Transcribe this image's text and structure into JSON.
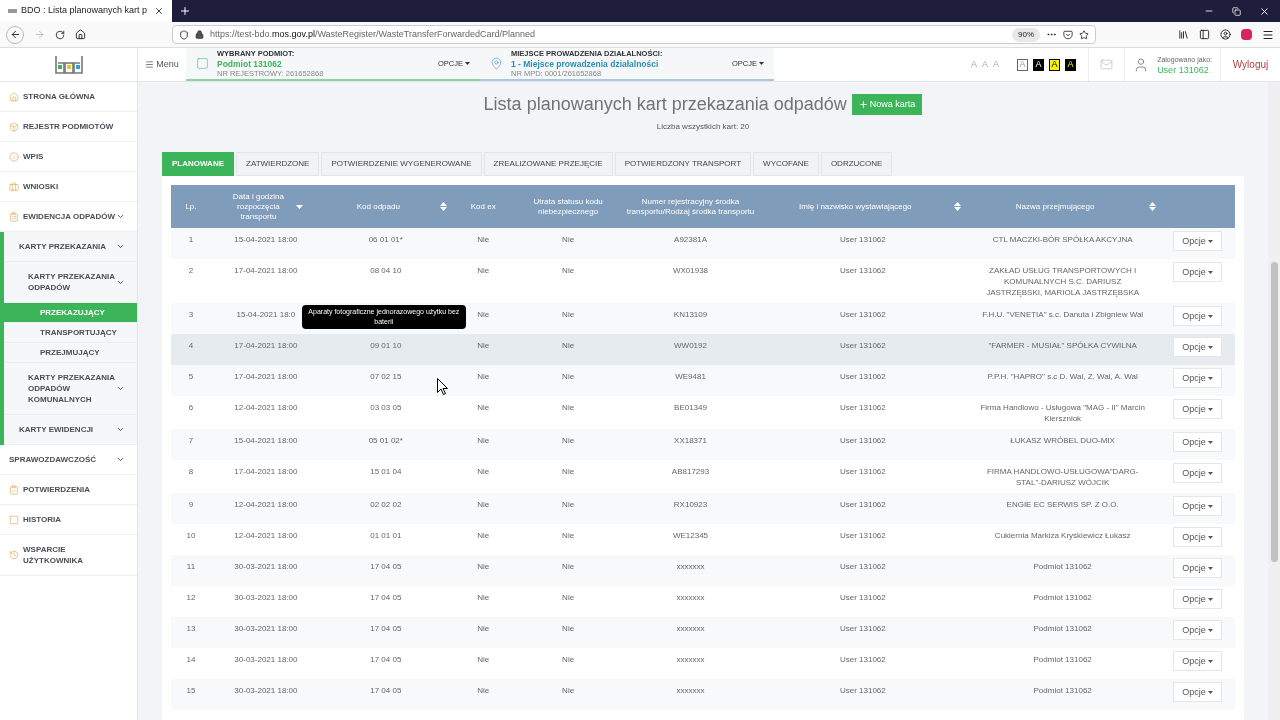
{
  "browser": {
    "tab_title": "BDO : Lista planowanych kart p",
    "url_host_prefix": "https://test-bdo.",
    "url_host": "mos.gov.pl",
    "url_path": "/WasteRegister/WasteTransferForwardedCard/Planned",
    "zoom": "90%"
  },
  "header": {
    "menu": "Menu",
    "subject": {
      "label": "WYBRANY PODMIOT:",
      "value": "Podmiot 131062",
      "sub": "NR REJESTROWY: 261652868",
      "options": "OPCJE"
    },
    "place": {
      "label": "MIEJSCE PROWADZENIA DZIAŁALNOŚCI:",
      "value": "1 - Miejsce prowadzenia działalności",
      "sub": "NR MPD: 0001/261652868",
      "options": "OPCJE"
    },
    "font_sizes": [
      "A",
      "A",
      "A"
    ],
    "contrast": [
      {
        "label": "A",
        "kind": "default"
      },
      {
        "label": "A",
        "kind": "dark"
      },
      {
        "label": "A",
        "kind": "yellow"
      },
      {
        "label": "A",
        "kind": "black-yellow"
      }
    ],
    "logged_label": "Zalogowano jako:",
    "user": "User 131062",
    "logout": "Wyloguj"
  },
  "sidebar": [
    {
      "label": "STRONA GŁÓWNA",
      "submenu": false
    },
    {
      "label": "REJESTR PODMIOTÓW",
      "submenu": false
    },
    {
      "label": "WPIS",
      "submenu": false
    },
    {
      "label": "WNIOSKI",
      "submenu": false
    },
    {
      "label": "EWIDENCJA ODPADÓW",
      "submenu": true,
      "children": [
        {
          "label": "KARTY PRZEKAZANIA",
          "submenu": true,
          "children": [
            {
              "label": "KARTY PRZEKAZANIA ODPADÓW",
              "submenu": true,
              "children": [
                {
                  "label": "PRZEKAZUJĄCY",
                  "selected": true
                },
                {
                  "label": "TRANSPORTUJĄCY",
                  "selected": false
                },
                {
                  "label": "PRZEJMUJĄCY",
                  "selected": false
                }
              ]
            },
            {
              "label": "KARTY PRZEKAZANIA ODPADÓW KOMUNALNYCH",
              "submenu": true
            }
          ]
        },
        {
          "label": "KARTY EWIDENCJI",
          "submenu": true
        }
      ]
    },
    {
      "label": "SPRAWOZDAWCZOŚĆ",
      "submenu": true
    },
    {
      "label": "POTWIERDZENIA",
      "submenu": false
    },
    {
      "label": "HISTORIA",
      "submenu": false
    },
    {
      "label": "WSPARCIE UŻYTKOWNIKA",
      "submenu": false
    }
  ],
  "page": {
    "title": "Lista planowanych kart przekazania odpadów",
    "new_button": "Nowa karta",
    "count": "Liczba wszystkich kart: 20"
  },
  "tabs": [
    {
      "label": "PLANOWANE",
      "selected": true
    },
    {
      "label": "ZATWIERDZONE",
      "selected": false
    },
    {
      "label": "POTWIERDZENIE WYGENEROWANE",
      "selected": false
    },
    {
      "label": "ZREALIZOWANE PRZEJĘCIE",
      "selected": false
    },
    {
      "label": "POTWIERDZONY TRANSPORT",
      "selected": false
    },
    {
      "label": "WYCOFANE",
      "selected": false
    },
    {
      "label": "ODRZUCONE",
      "selected": false
    }
  ],
  "table": {
    "columns": [
      {
        "label": "Lp.",
        "sortable": false
      },
      {
        "label": "Data i godzina rozpoczęcia transportu",
        "sortable": true,
        "sorted": true
      },
      {
        "label": "Kod odpadu",
        "sortable": true,
        "sorted": false
      },
      {
        "label": "Kod ex",
        "sortable": false
      },
      {
        "label": "Utrata statusu kodu niebezpiecznego",
        "sortable": false
      },
      {
        "label": "Numer rejestracyjny środka transportu/Rodzaj środka transportu",
        "sortable": false
      },
      {
        "label": "Imię i nazwisko wystawiającego",
        "sortable": true,
        "sorted": false
      },
      {
        "label": "Nazwa przejmującego",
        "sortable": true,
        "sorted": false
      }
    ],
    "rows": [
      {
        "lp": "1",
        "date": "15-04-2021 18:00",
        "code": "06 01 01*",
        "ex": "Nie",
        "lost": "Nie",
        "vehicle": "A92381A",
        "issuer": "User 131062",
        "receiver": "CTL MACZKI-BÓR SPÓŁKA AKCYJNA",
        "options": "Opcje",
        "hovered": false
      },
      {
        "lp": "2",
        "date": "17-04-2021 18:00",
        "code": "08 04 10",
        "ex": "Nie",
        "lost": "Nie",
        "vehicle": "WX01938",
        "issuer": "User 131062",
        "receiver": "ZAKŁAD USŁUG TRANSPORTOWYCH I KOMUNALNYCH S.C. DARIUSZ JASTRZĘBSKI, MARIOLA JASTRZĘBSKA",
        "options": "Opcje",
        "hovered": false
      },
      {
        "lp": "3",
        "date": "15-04-2021 18:0",
        "tooltip": "Aparaty fotograficzne jednorazowego użytku bez baterii",
        "ex": "Nie",
        "lost": "Nie",
        "vehicle": "KN13109",
        "issuer": "User 131062",
        "receiver": "F.H.U. \"VENETIA\" s.c. Danuta i Zbigniew Wal",
        "options": "Opcje",
        "hovered": false
      },
      {
        "lp": "4",
        "date": "17-04-2021 18:00",
        "code": "09 01 10",
        "ex": "Nie",
        "lost": "Nie",
        "vehicle": "WW0192",
        "issuer": "User 131062",
        "receiver": "\"FARMER - MUSIAŁ\" SPÓŁKA CYWILNA",
        "options": "Opcje",
        "hovered": true
      },
      {
        "lp": "5",
        "date": "17-04-2021 18:00",
        "code": "07 02 15",
        "ex": "Nie",
        "lost": "Nie",
        "vehicle": "WE9481",
        "issuer": "User 131062",
        "receiver": "P.P.H. \"HAPRO\" s.c D. Wal, Z. Wal, A. Wal",
        "options": "Opcje",
        "hovered": false
      },
      {
        "lp": "6",
        "date": "12-04-2021 18:00",
        "code": "03 03 05",
        "ex": "Nie",
        "lost": "Nie",
        "vehicle": "BE01349",
        "issuer": "User 131062",
        "receiver": "Firma Handlowo - Usługowa \"MAG - II\" Marcin Kierszniok",
        "options": "Opcje",
        "hovered": false
      },
      {
        "lp": "7",
        "date": "15-04-2021 18:00",
        "code": "05 01 02*",
        "ex": "Nie",
        "lost": "Nie",
        "vehicle": "XX18371",
        "issuer": "User 131062",
        "receiver": "ŁUKASZ WRÓBEL DUO-MIX",
        "options": "Opcje",
        "hovered": false
      },
      {
        "lp": "8",
        "date": "17-04-2021 18:00",
        "code": "15 01 04",
        "ex": "Nie",
        "lost": "Nie",
        "vehicle": "AB817293",
        "issuer": "User 131062",
        "receiver": "FIRMA HANDLOWO-USŁUGOWA\"DARG-STAL\"-DARIUSZ WÓJCIK",
        "options": "Opcje",
        "hovered": false
      },
      {
        "lp": "9",
        "date": "12-04-2021 18:00",
        "code": "02 02 02",
        "ex": "Nie",
        "lost": "Nie",
        "vehicle": "RX10923",
        "issuer": "User 131062",
        "receiver": "ENGIE EC SERWIS SP. Z O.O.",
        "options": "Opcje",
        "hovered": false
      },
      {
        "lp": "10",
        "date": "12-04-2021 18:00",
        "code": "01 01 01",
        "ex": "Nie",
        "lost": "Nie",
        "vehicle": "WE12345",
        "issuer": "User 131062",
        "receiver": "Cukiernia Markiza Kryśkiewicz Łukasz",
        "options": "Opcje",
        "hovered": false
      },
      {
        "lp": "11",
        "date": "30-03-2021 18:00",
        "code": "17 04 05",
        "ex": "Nie",
        "lost": "Nie",
        "vehicle": "xxxxxxx",
        "issuer": "User 131062",
        "receiver": "Podmiot 131062",
        "options": "Opcje",
        "hovered": false
      },
      {
        "lp": "12",
        "date": "30-03-2021 18:00",
        "code": "17 04 05",
        "ex": "Nie",
        "lost": "Nie",
        "vehicle": "xxxxxxx",
        "issuer": "User 131062",
        "receiver": "Podmiot 131062",
        "options": "Opcje",
        "hovered": false
      },
      {
        "lp": "13",
        "date": "30-03-2021 18:00",
        "code": "17 04 05",
        "ex": "Nie",
        "lost": "Nie",
        "vehicle": "xxxxxxx",
        "issuer": "User 131062",
        "receiver": "Podmiot 131062",
        "options": "Opcje",
        "hovered": false
      },
      {
        "lp": "14",
        "date": "30-03-2021 18:00",
        "code": "17 04 05",
        "ex": "Nie",
        "lost": "Nie",
        "vehicle": "xxxxxxx",
        "issuer": "User 131062",
        "receiver": "Podmiot 131062",
        "options": "Opcje",
        "hovered": false
      },
      {
        "lp": "15",
        "date": "30-03-2021 18:00",
        "code": "17 04 05",
        "ex": "Nie",
        "lost": "Nie",
        "vehicle": "xxxxxxx",
        "issuer": "User 131062",
        "receiver": "Podmiot 131062",
        "options": "Opcje",
        "hovered": false
      }
    ]
  }
}
